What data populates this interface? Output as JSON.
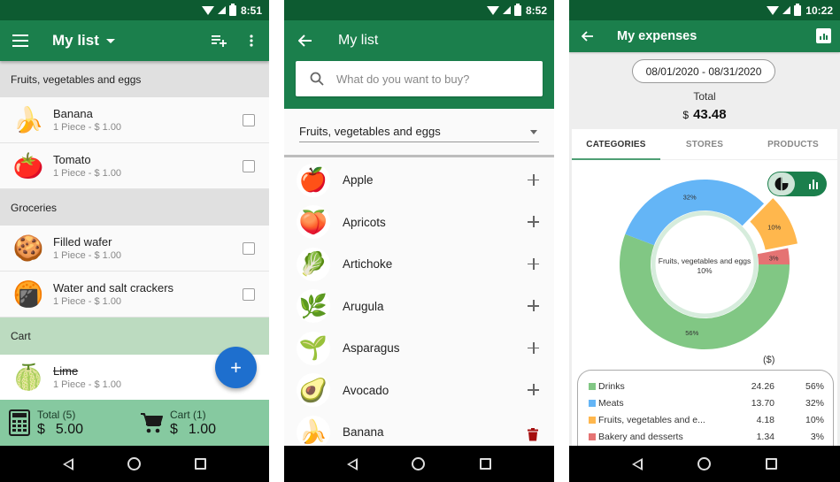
{
  "phone1": {
    "status": {
      "time": "8:51"
    },
    "appbar": {
      "title": "My list",
      "menu_icon": "hamburger-menu-icon",
      "add_list_icon": "playlist-add-icon",
      "overflow_icon": "more-vert-icon"
    },
    "sections": [
      {
        "title": "Fruits, vegetables and eggs",
        "items": [
          {
            "name": "Banana",
            "detail": "1 Piece - $ 1.00",
            "icon": "🍌",
            "checked": false
          },
          {
            "name": "Tomato",
            "detail": "1 Piece - $ 1.00",
            "icon": "🍅",
            "checked": false
          }
        ]
      },
      {
        "title": "Groceries",
        "items": [
          {
            "name": "Filled wafer",
            "detail": "1 Piece - $ 1.00",
            "icon": "🍪",
            "checked": false
          },
          {
            "name": "Water and salt crackers",
            "detail": "1 Piece - $ 1.00",
            "icon": "🍘",
            "checked": false
          }
        ]
      },
      {
        "title": "Cart",
        "items": [
          {
            "name": "Lime",
            "detail": "1 Piece - $ 1.00",
            "icon": "🍈",
            "checked": true
          }
        ]
      }
    ],
    "fab": {
      "label": "+"
    },
    "totals": {
      "total_label": "Total (5)",
      "total_currency": "$",
      "total_value": "5.00",
      "cart_label": "Cart (1)",
      "cart_currency": "$",
      "cart_value": "1.00"
    }
  },
  "phone2": {
    "status": {
      "time": "8:52"
    },
    "appbar": {
      "title": "My list"
    },
    "search": {
      "placeholder": "What do you want to buy?",
      "value": ""
    },
    "category": {
      "selected": "Fruits, vegetables and eggs"
    },
    "products": [
      {
        "name": "Apple",
        "icon": "🍎",
        "action": "add"
      },
      {
        "name": "Apricots",
        "icon": "🍑",
        "action": "add"
      },
      {
        "name": "Artichoke",
        "icon": "🥬",
        "action": "add"
      },
      {
        "name": "Arugula",
        "icon": "🌿",
        "action": "add"
      },
      {
        "name": "Asparagus",
        "icon": "🌱",
        "action": "add"
      },
      {
        "name": "Avocado",
        "icon": "🥑",
        "action": "add"
      },
      {
        "name": "Banana",
        "icon": "🍌",
        "action": "delete"
      }
    ],
    "colors": {
      "delete": "#a50e0e"
    }
  },
  "phone3": {
    "status": {
      "time": "10:22"
    },
    "appbar": {
      "title": "My expenses"
    },
    "date_range": "08/01/2020 - 08/31/2020",
    "total": {
      "label": "Total",
      "currency": "$",
      "value": "43.48"
    },
    "tabs": [
      {
        "label": "CATEGORIES",
        "active": true
      },
      {
        "label": "STORES",
        "active": false
      },
      {
        "label": "PRODUCTS",
        "active": false
      }
    ],
    "legend_unit": "($)",
    "chart_data": {
      "type": "pie",
      "variant": "donut",
      "title": "",
      "center_label": "Fruits, vegetables and eggs",
      "center_value": "10%",
      "highlighted": "Fruits, vegetables and eggs",
      "slices": [
        {
          "name": "Drinks",
          "legend_name": "Drinks",
          "amount": 24.26,
          "percent_label": "56%",
          "color": "#81c784"
        },
        {
          "name": "Meats",
          "legend_name": "Meats",
          "amount": 13.7,
          "percent_label": "32%",
          "color": "#64b5f6"
        },
        {
          "name": "Fruits, vegetables and eggs",
          "legend_name": "Fruits, vegetables and e...",
          "amount": 4.18,
          "percent_label": "10%",
          "color": "#ffb74d"
        },
        {
          "name": "Bakery and desserts",
          "legend_name": "Bakery and desserts",
          "amount": 1.34,
          "percent_label": "3%",
          "color": "#e57373"
        }
      ],
      "legend_placement": "bottom"
    }
  },
  "colors": {
    "status_bar": "#0d5b31",
    "app_bar": "#1b7f4c",
    "fab": "#1e6fce",
    "totals_bar": "#86c9a0",
    "cart_header": "#bcdbc0"
  }
}
